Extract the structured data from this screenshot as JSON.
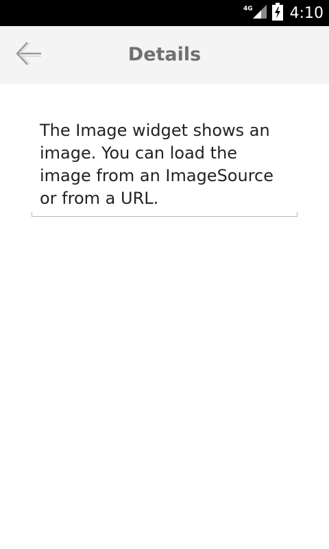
{
  "status_bar": {
    "network_label": "4G",
    "time": "4:10",
    "icons": [
      "signal-icon",
      "battery-charging-icon"
    ]
  },
  "toolbar": {
    "back_icon": "arrow-left-icon",
    "title": "Details"
  },
  "content": {
    "description": "The Image widget shows an image. You can load the image from an ImageSource or from a URL."
  }
}
